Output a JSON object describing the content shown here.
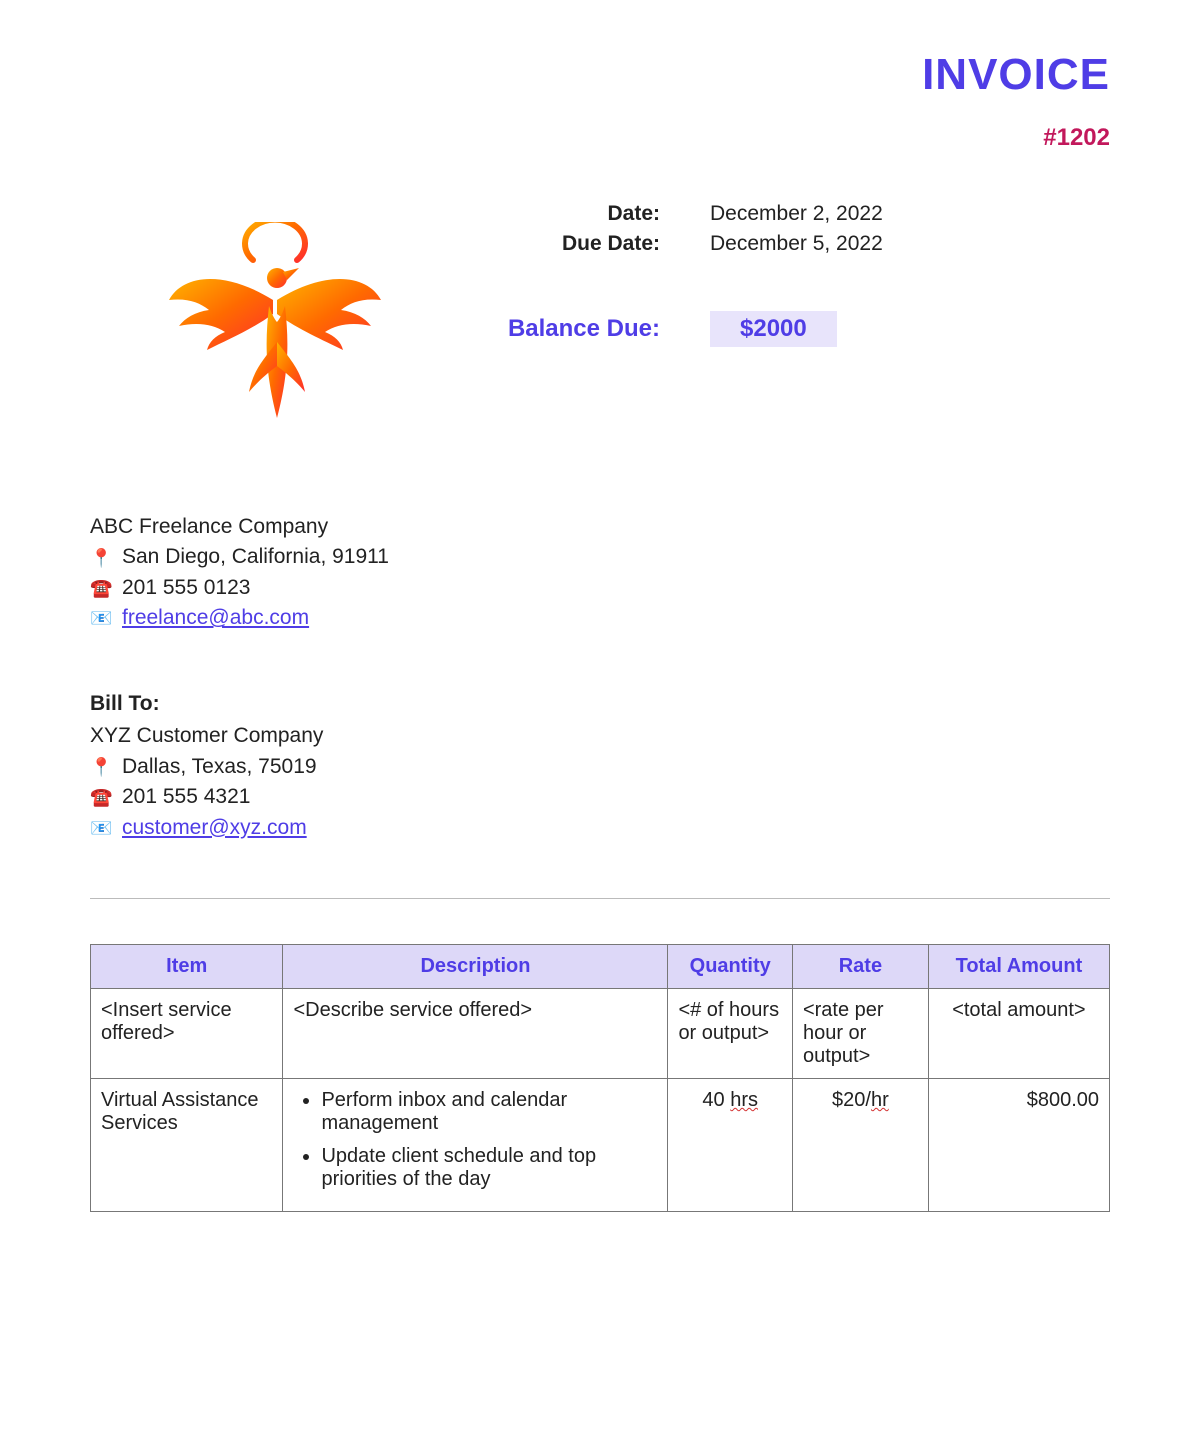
{
  "header": {
    "title": "INVOICE",
    "number": "#1202"
  },
  "meta": {
    "date_label": "Date:",
    "date_value": "December 2, 2022",
    "due_label": "Due Date:",
    "due_value": "December 5, 2022",
    "balance_label": "Balance Due:",
    "balance_value": "$2000"
  },
  "from": {
    "name": "ABC Freelance Company",
    "address": "San Diego, California, 91911",
    "phone": "201 555 0123",
    "email": "freelance@abc.com"
  },
  "bill_to": {
    "heading": "Bill To:",
    "name": "XYZ Customer Company",
    "address": "Dallas, Texas, 75019",
    "phone": "201 555 4321",
    "email": "customer@xyz.com"
  },
  "table": {
    "headers": {
      "item": "Item",
      "description": "Description",
      "quantity": "Quantity",
      "rate": "Rate",
      "total": "Total Amount"
    },
    "rows": [
      {
        "item": "<Insert service offered>",
        "description": "<Describe service offered>",
        "quantity": "<# of hours or output>",
        "rate": "<rate per hour or output>",
        "total": "<total amount>"
      },
      {
        "item": "Virtual Assistance Services",
        "desc_bullets": [
          "Perform inbox and calendar management",
          "Update client schedule and top priorities of the day"
        ],
        "quantity_num": "40 ",
        "quantity_unit": "hrs",
        "rate_num": "$20/",
        "rate_unit": "hr",
        "total": "$800.00"
      }
    ]
  }
}
